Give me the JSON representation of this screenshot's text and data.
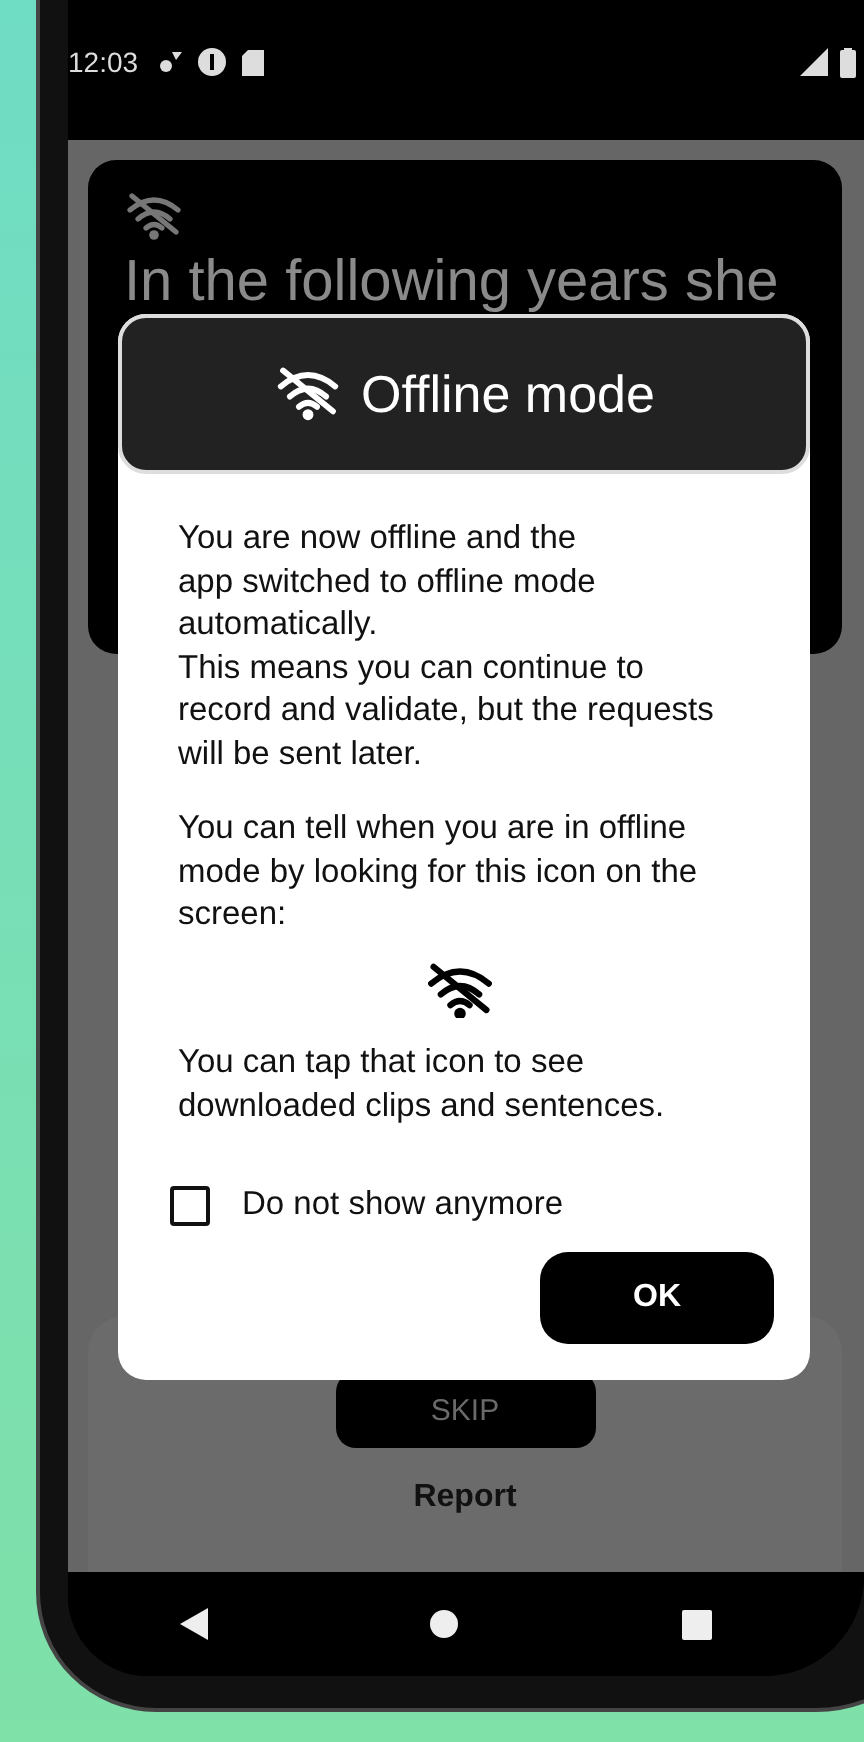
{
  "status_bar": {
    "time": "12:03"
  },
  "card": {
    "sentence": "In the following years she"
  },
  "dialog": {
    "title": "Offline mode",
    "paragraphs": [
      "You are now offline and the\napp switched to offline mode\nautomatically.\nThis means you can continue to record and validate, but the requests will be sent later.",
      "You can tell when you are in offline mode by looking for this icon on the screen:",
      "You can tap that icon to see downloaded clips and sentences."
    ],
    "checkbox": {
      "label": "Do not show anymore",
      "checked": false
    },
    "ok_button": "OK"
  },
  "actions": {
    "skip": "SKIP",
    "report": "Report"
  }
}
